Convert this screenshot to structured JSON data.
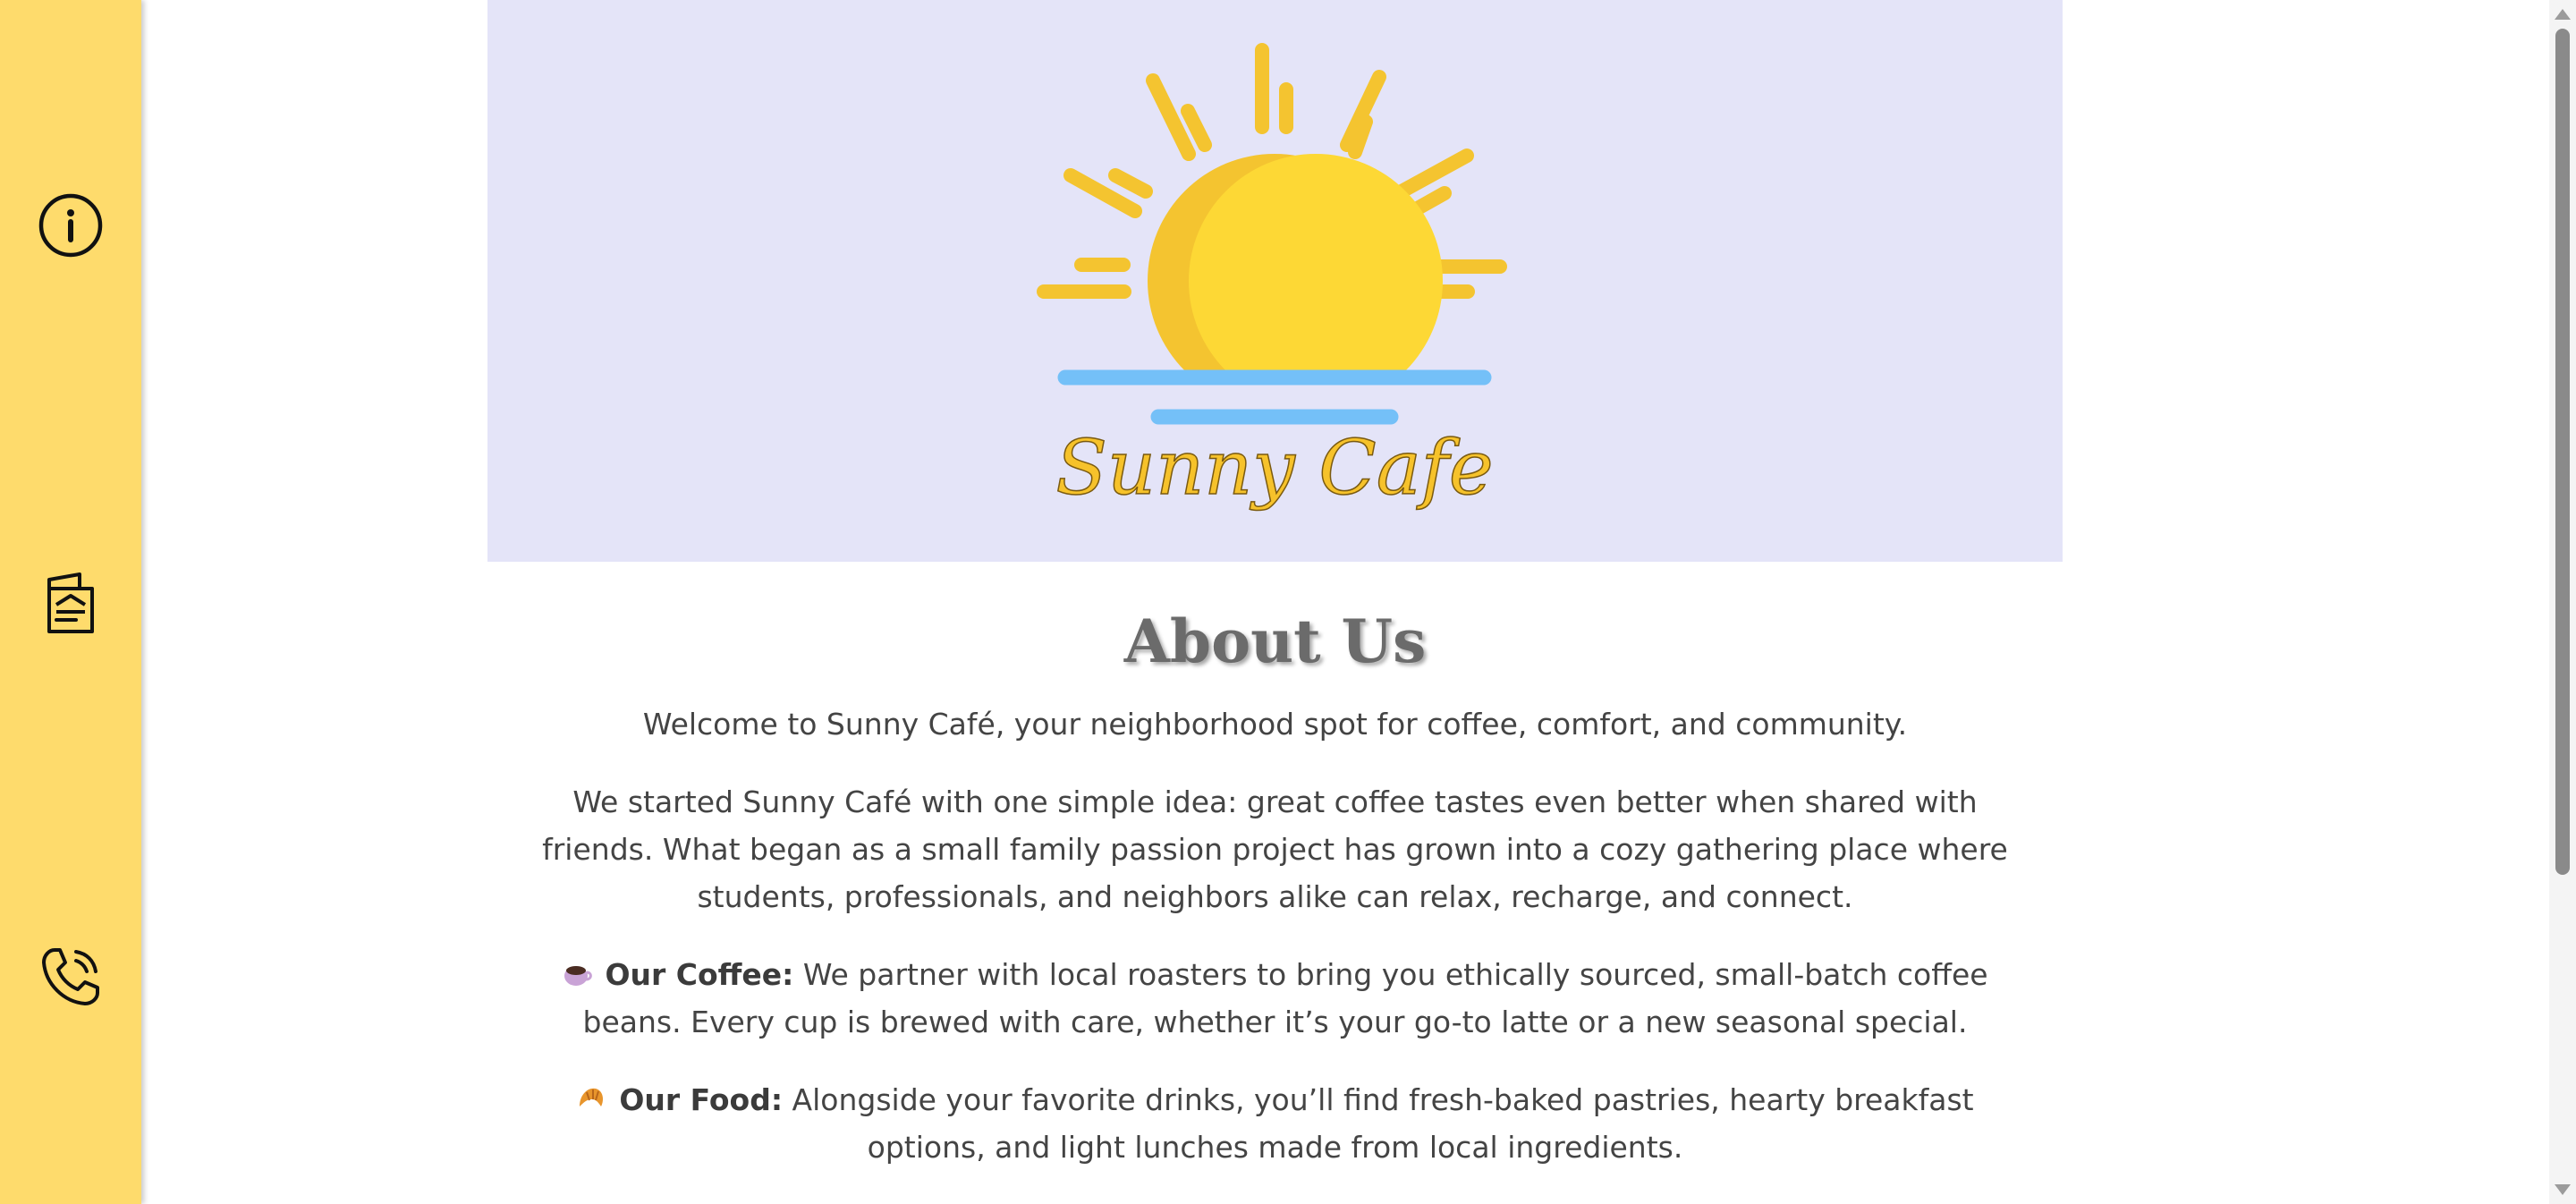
{
  "sidebar": {
    "items": [
      {
        "icon": "info-icon"
      },
      {
        "icon": "menu-icon"
      },
      {
        "icon": "phone-icon"
      }
    ]
  },
  "banner": {
    "logo_text": "Sunny Cafe"
  },
  "about": {
    "heading": "About Us",
    "intro": "Welcome to Sunny Café, your neighborhood spot for coffee, comfort, and community.",
    "story": "We started Sunny Café with one simple idea: great coffee tastes even better when shared with friends. What began as a small family passion project has grown into a cozy gathering place where students, professionals, and neighbors alike can relax, recharge, and connect.",
    "coffee": {
      "icon": "coffee-cup-icon",
      "label": "Our Coffee:",
      "text": " We partner with local roasters to bring you ethically sourced, small-batch coffee beans. Every cup is brewed with care, whether it’s your go-to latte or a new seasonal special."
    },
    "food": {
      "icon": "croissant-icon",
      "label": "Our Food:",
      "text": " Alongside your favorite drinks, you’ll find fresh-baked pastries, hearty breakfast options, and light lunches made from local ingredients."
    }
  },
  "colors": {
    "sidebar": "#fedb6c",
    "banner_bg": "#e4e4f8",
    "sun": "#fdd835",
    "sun_shadow": "#f4c430",
    "water": "#74c0f8"
  }
}
